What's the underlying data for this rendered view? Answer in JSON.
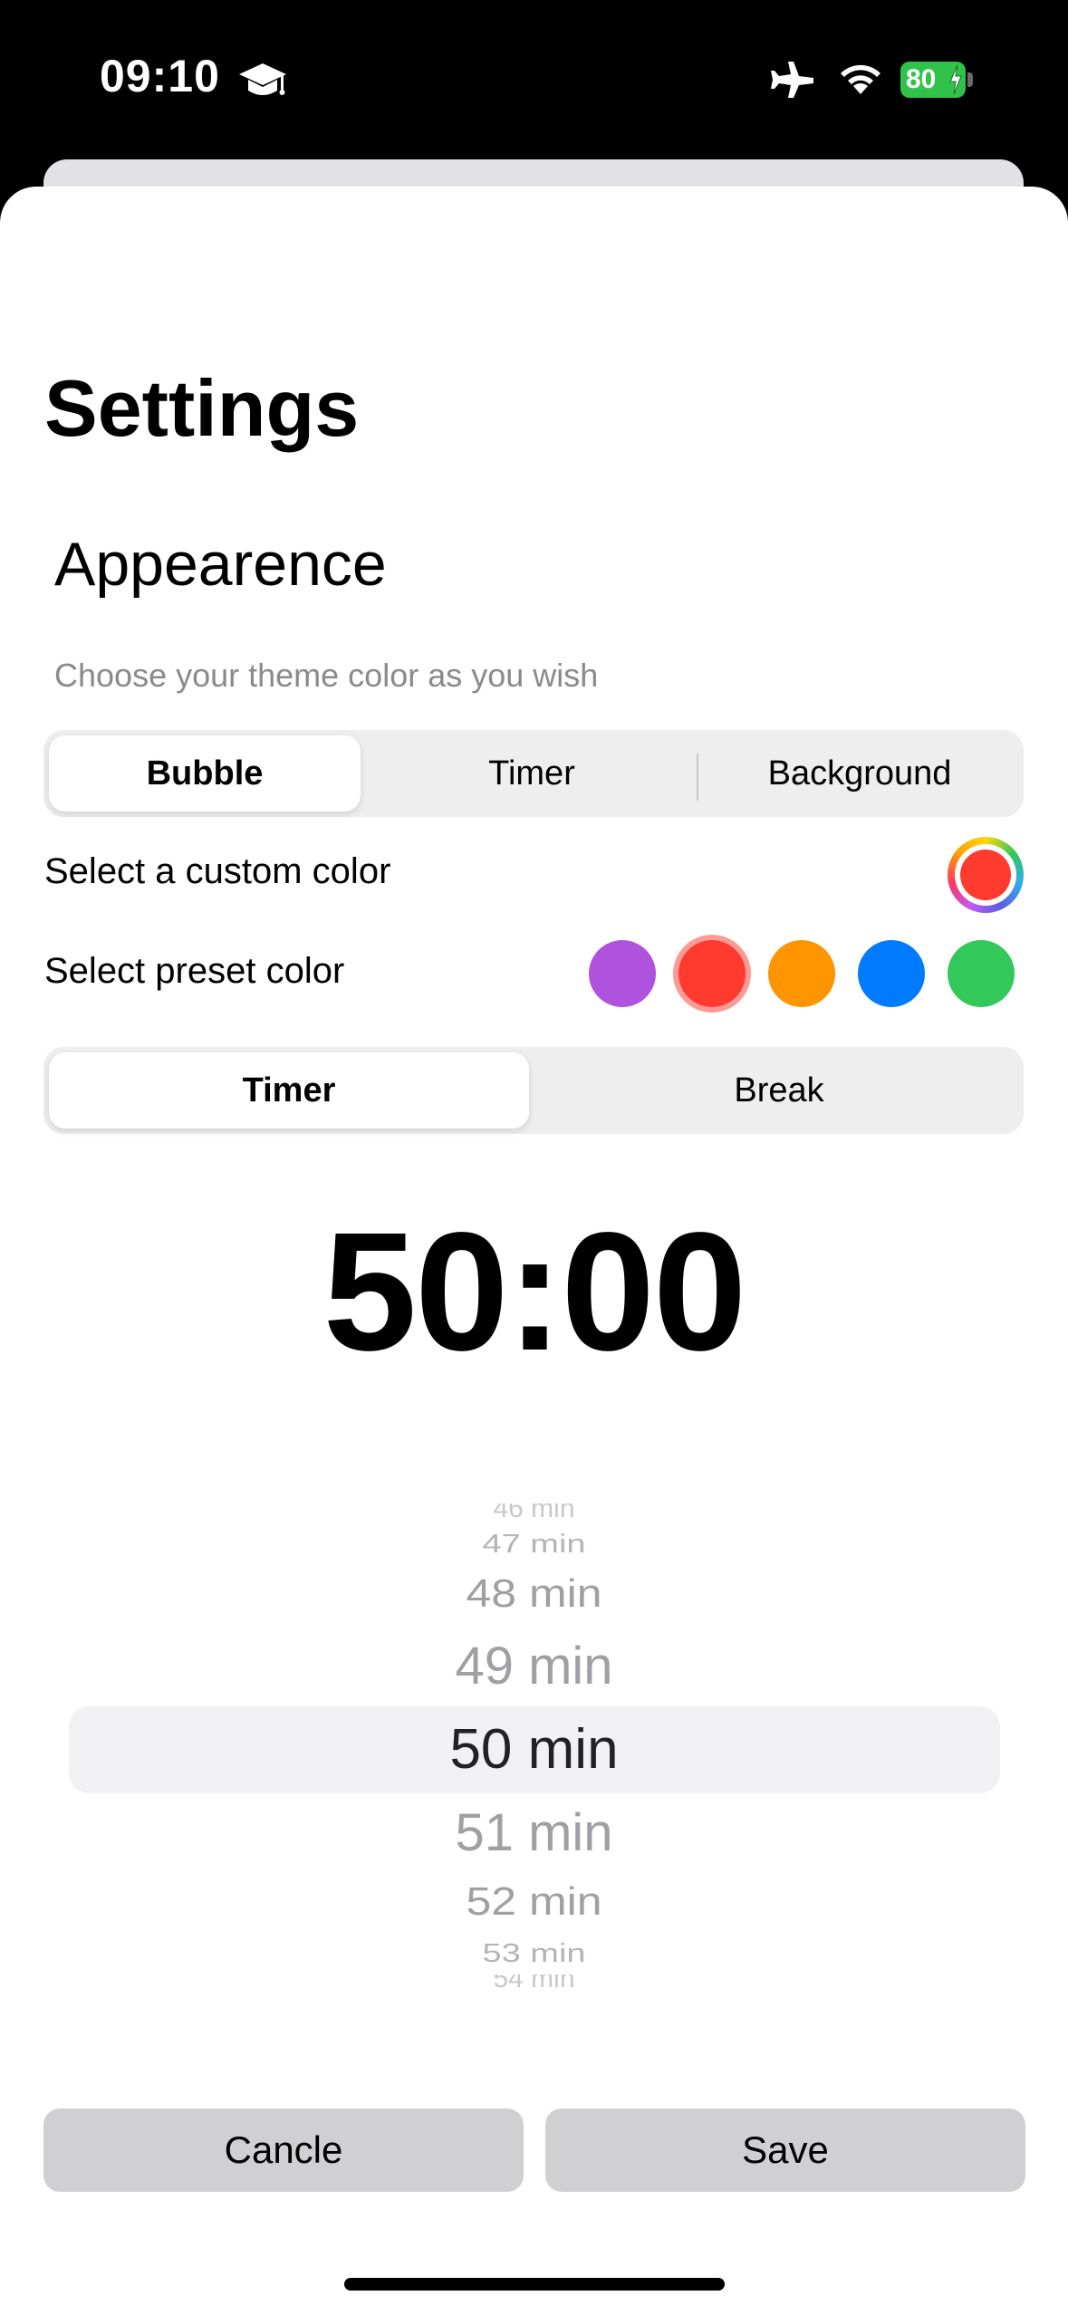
{
  "status_bar": {
    "time": "09:10",
    "battery": "80",
    "icons": [
      "graduation-cap-icon",
      "airplane-icon",
      "wifi-icon",
      "battery-icon",
      "bolt-icon"
    ]
  },
  "page": {
    "title": "Settings",
    "section_title": "Appearence",
    "subtitle": "Choose your theme color as you wish"
  },
  "theme_tabs": [
    {
      "label": "Bubble",
      "selected": true
    },
    {
      "label": "Timer",
      "selected": false
    },
    {
      "label": "Background",
      "selected": false
    }
  ],
  "custom_color": {
    "label": "Select a custom color",
    "value": "#ff3b30"
  },
  "preset_color": {
    "label": "Select preset color",
    "options": [
      {
        "name": "purple",
        "color": "#af52de",
        "selected": false
      },
      {
        "name": "red",
        "color": "#ff3b30",
        "selected": true
      },
      {
        "name": "orange",
        "color": "#ff9500",
        "selected": false
      },
      {
        "name": "blue",
        "color": "#007aff",
        "selected": false
      },
      {
        "name": "green",
        "color": "#34c759",
        "selected": false
      }
    ]
  },
  "mode_tabs": [
    {
      "label": "Timer",
      "selected": true
    },
    {
      "label": "Break",
      "selected": false
    }
  ],
  "timer_display": "50:00",
  "duration_picker": {
    "items": [
      "46 min",
      "47 min",
      "48 min",
      "49 min",
      "50 min",
      "51 min",
      "52 min",
      "53 min",
      "54 min"
    ],
    "selected": "50 min"
  },
  "actions": {
    "cancel_label": "Cancle",
    "save_label": "Save"
  }
}
